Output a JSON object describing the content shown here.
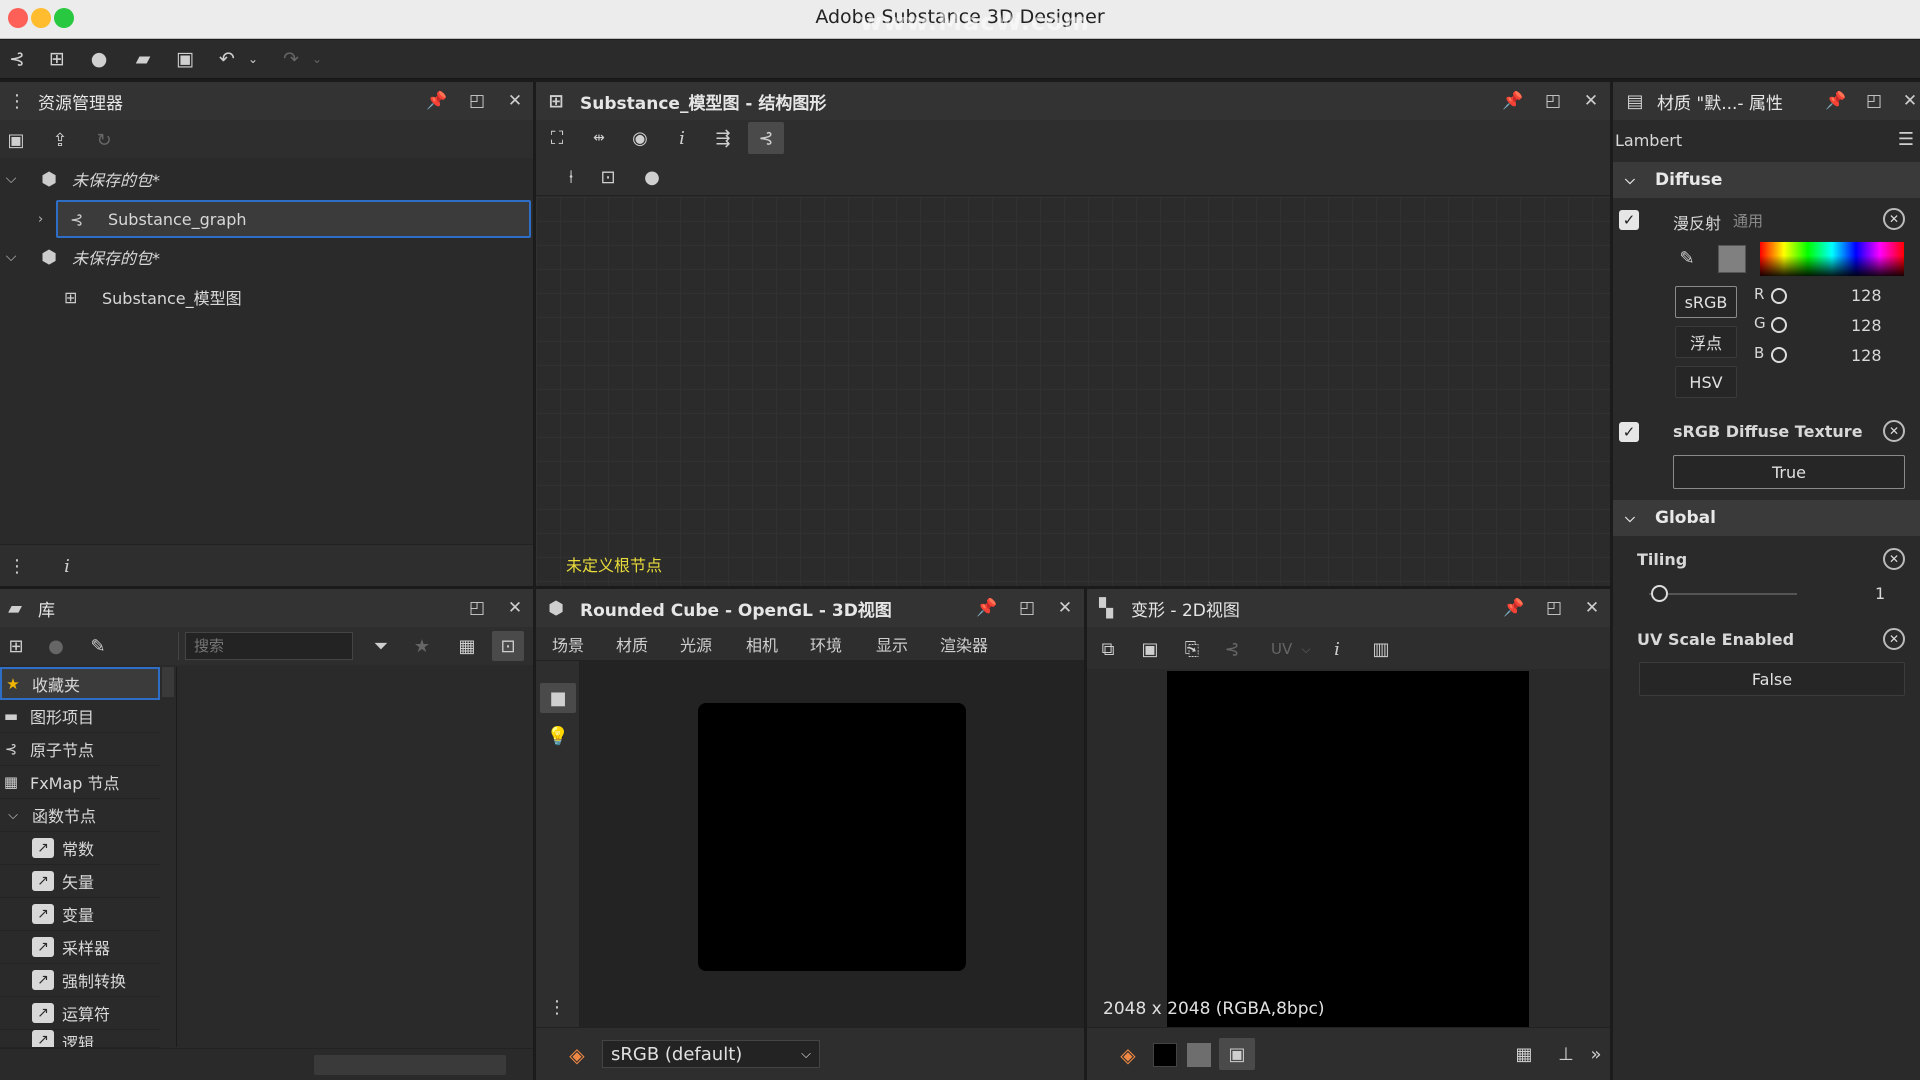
{
  "window": {
    "title": "Adobe Substance 3D Designer",
    "watermark": "www.MacW.com"
  },
  "explorer": {
    "title": "资源管理器",
    "packages": [
      {
        "name": "未保存的包*",
        "child": "Substance_graph"
      },
      {
        "name": "未保存的包*",
        "child": "Substance_模型图"
      }
    ]
  },
  "graph": {
    "title": "Substance_模型图 - 结构图形",
    "status": "未定义根节点"
  },
  "properties": {
    "title": "材质 \"默...- 属性",
    "shader": "Lambert",
    "diffuse_section": "Diffuse",
    "diffuse_label": "漫反射",
    "diffuse_sub": "通用",
    "modes": [
      "sRGB",
      "浮点",
      "HSV"
    ],
    "channels": [
      {
        "name": "R",
        "value": "128"
      },
      {
        "name": "G",
        "value": "128"
      },
      {
        "name": "B",
        "value": "128"
      }
    ],
    "srgb_tex_label": "sRGB Diffuse Texture",
    "srgb_tex_value": "True",
    "global_section": "Global",
    "tiling_label": "Tiling",
    "tiling_value": "1",
    "uv_label": "UV Scale Enabled",
    "uv_value": "False",
    "colors": {
      "swatch": "#808080"
    }
  },
  "library": {
    "title": "库",
    "search_placeholder": "搜索",
    "items": [
      "收藏夹",
      "图形项目",
      "原子节点",
      "FxMap 节点",
      "函数节点"
    ],
    "function_items": [
      "常数",
      "矢量",
      "变量",
      "采样器",
      "强制转换",
      "运算符",
      "逻辑"
    ]
  },
  "view3d": {
    "title": "Rounded Cube - OpenGL - 3D视图",
    "menu": [
      "场景",
      "材质",
      "光源",
      "相机",
      "环境",
      "显示",
      "渲染器"
    ],
    "colorspace": "sRGB (default)"
  },
  "view2d": {
    "title": "变形 - 2D视图",
    "uv_label": "UV",
    "resolution": "2048 x 2048 (RGBA,8bpc)"
  }
}
